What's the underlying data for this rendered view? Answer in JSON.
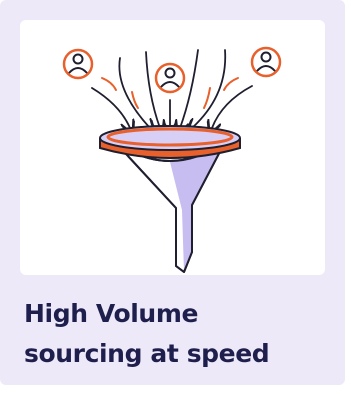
{
  "card": {
    "headline_line1": "High Volume",
    "headline_line2": "sourcing at speed"
  },
  "illustration": {
    "description_icons": [
      "candidate-avatar-icon",
      "candidate-avatar-icon",
      "candidate-avatar-icon",
      "sourcing-funnel-icon"
    ],
    "colors": {
      "accent": "#e8602c",
      "funnel_fill": "#c7bdf0",
      "outline": "#1f1f2f",
      "card_background": "#ede9f8",
      "headline": "#1f1f4d"
    }
  }
}
